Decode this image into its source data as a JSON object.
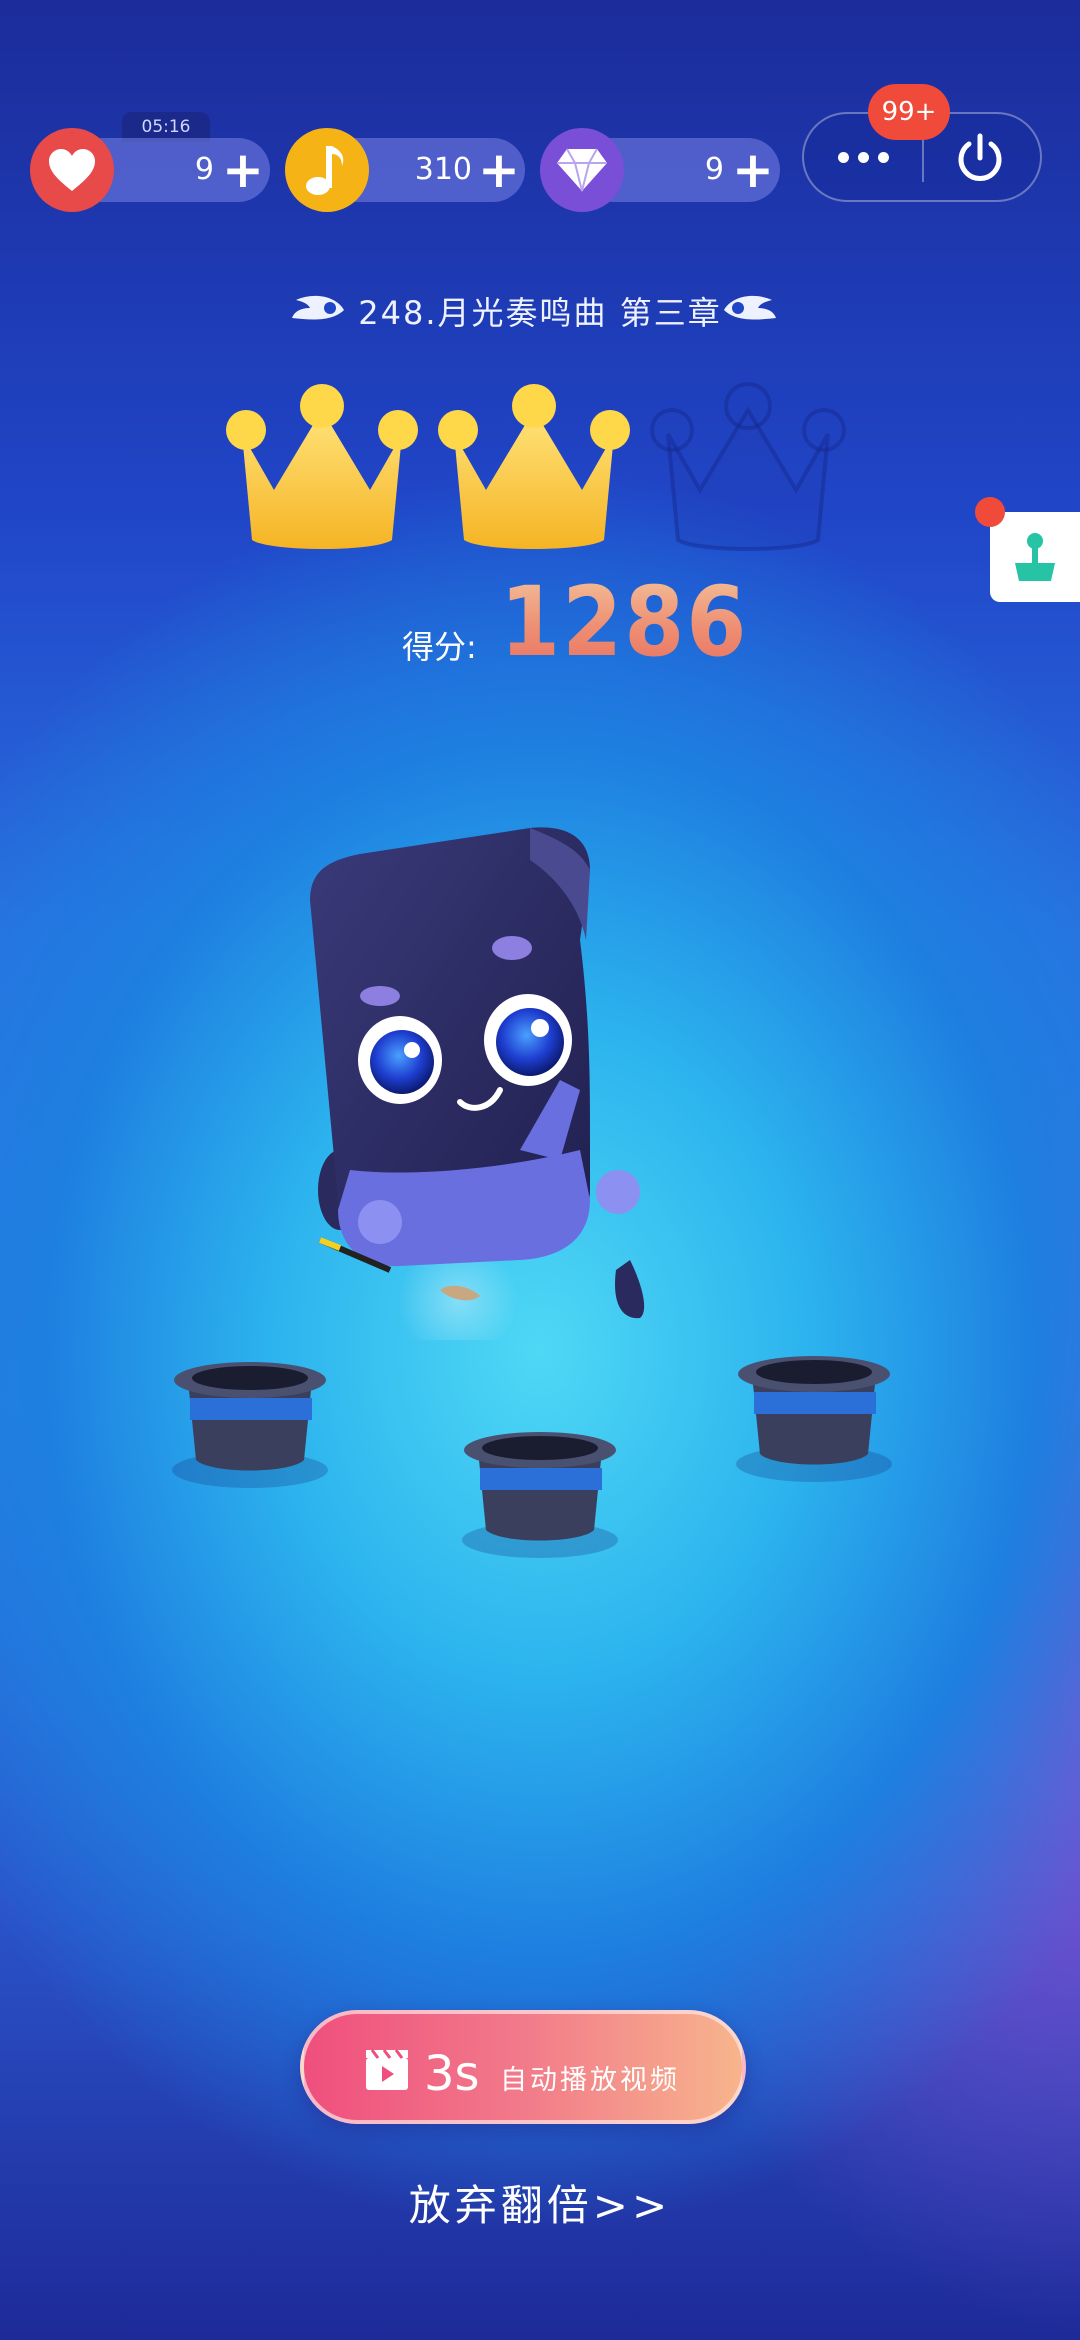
{
  "status": {
    "timer": "05:16",
    "hearts": "9",
    "notes": "310",
    "diamonds": "9",
    "notification_badge": "99+"
  },
  "level": {
    "chapter_title": "248.月光奏鸣曲 第三章",
    "crowns_earned": 2,
    "crowns_total": 3
  },
  "score": {
    "label": "得分:",
    "value": "1286"
  },
  "video_button": {
    "countdown": "3s",
    "label": "自动播放视频"
  },
  "give_up_link": "放弃翻倍>>",
  "colors": {
    "heart": "#e84a4a",
    "note": "#f5b316",
    "diamond": "#7a4fd8",
    "crown": "#fbc73a",
    "badge": "#f04a3a"
  }
}
